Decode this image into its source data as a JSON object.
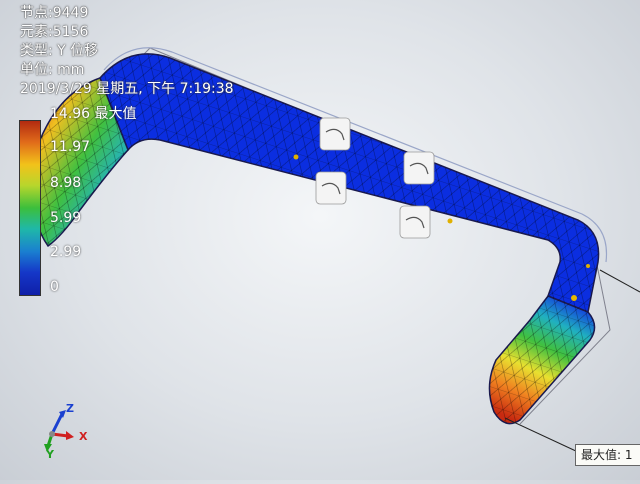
{
  "info": {
    "nodes": "节点:9449",
    "elements": "元素:5156",
    "type": "类型: Y 位移",
    "unit": "单位: mm",
    "timestamp": "2019/3/29 星期五, 下午 7:19:38"
  },
  "legend": {
    "labels": [
      "14.96 最大值",
      "11.97",
      "8.98",
      "5.99",
      "2.99",
      "0"
    ]
  },
  "callout": {
    "text": "最大值: 1"
  },
  "triad": {
    "z": "Z",
    "x": "X",
    "y": "Y"
  },
  "colors": {
    "mesh_blue": "#0b2ee0",
    "max_red": "#c81e0a",
    "background": "#dfe3e8"
  }
}
